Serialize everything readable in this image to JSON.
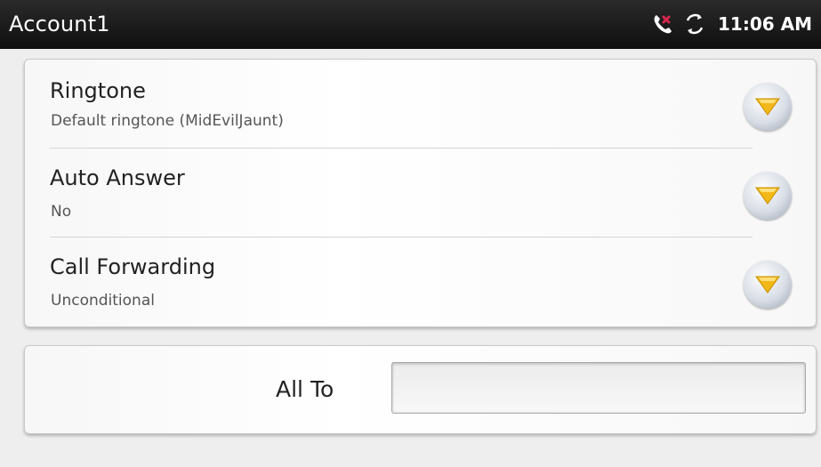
{
  "status_bar": {
    "title": "Account1",
    "time": "11:06 AM",
    "icons": [
      "missed-call-icon",
      "sync-icon"
    ]
  },
  "settings": {
    "items": [
      {
        "label": "Ringtone",
        "value": "Default ringtone (MidEvilJaunt)"
      },
      {
        "label": "Auto Answer",
        "value": "No"
      },
      {
        "label": "Call Forwarding",
        "value": "Unconditional"
      }
    ]
  },
  "forwarding": {
    "label": "All To",
    "value": ""
  },
  "colors": {
    "status_bar_bg": "#111111",
    "dropdown_arrow": "#f2b818",
    "missed_call": "#d9254c"
  }
}
